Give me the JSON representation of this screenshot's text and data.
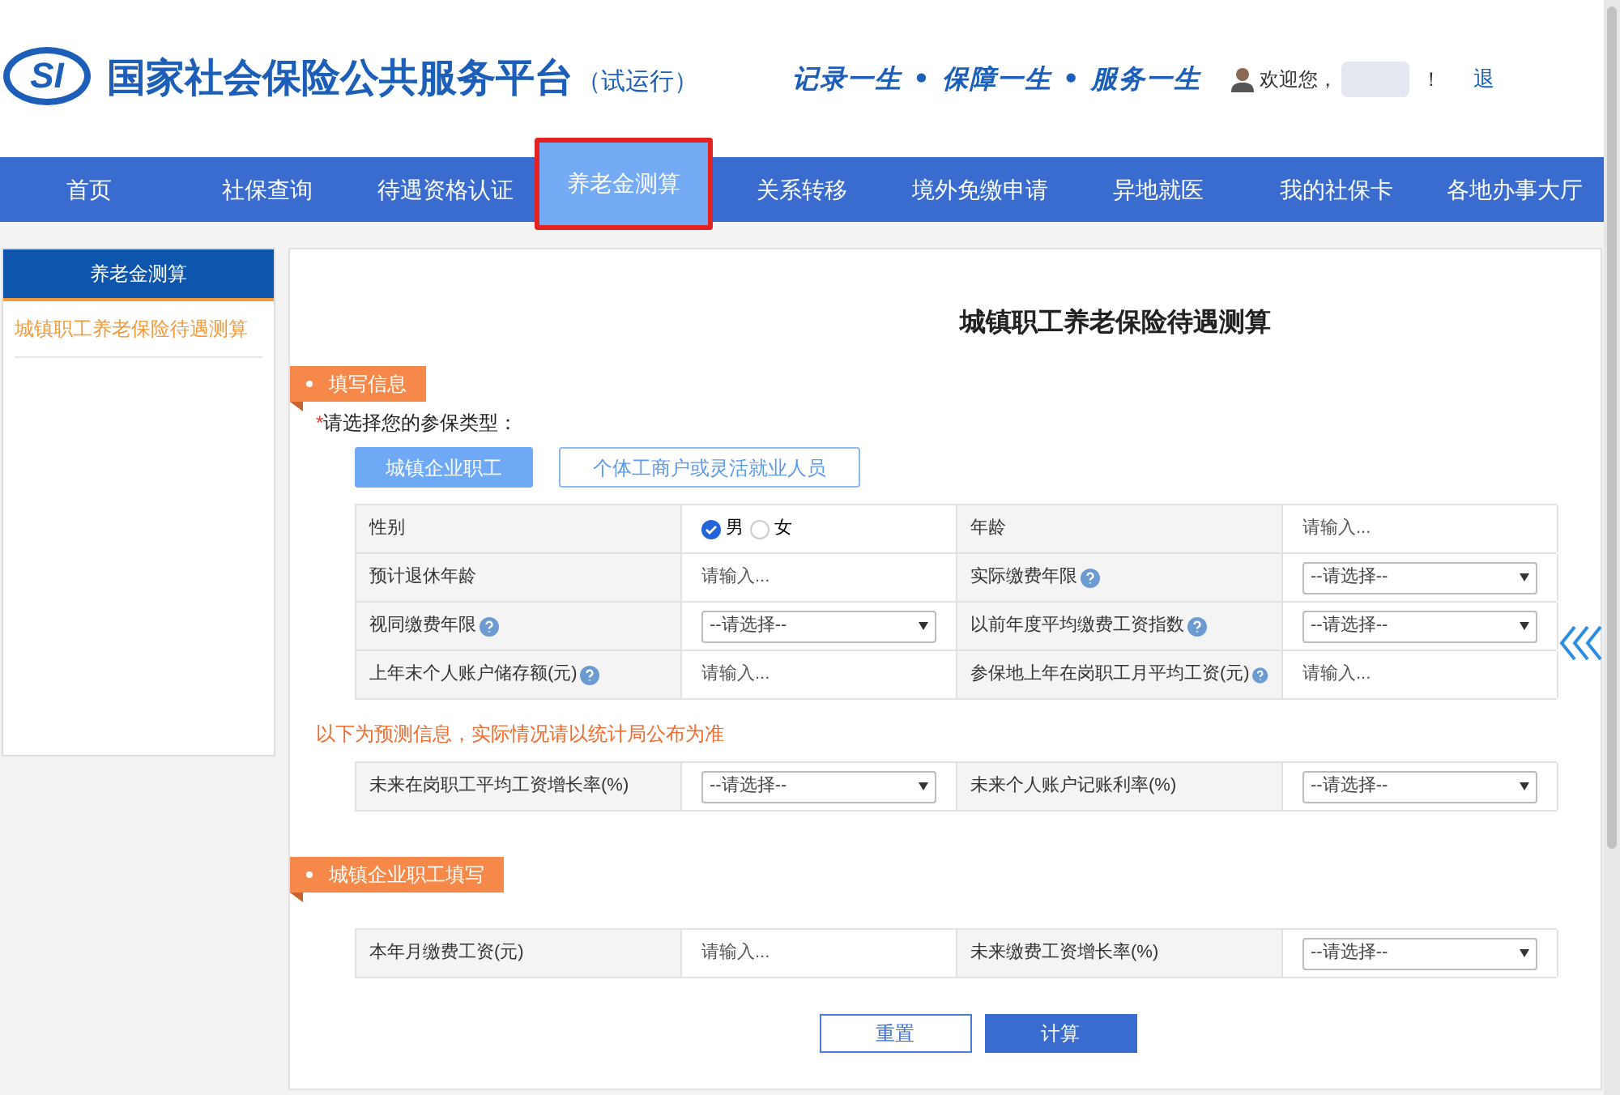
{
  "header": {
    "logo": "SI",
    "site_name": "国家社会保险公共服务平台",
    "trial": "（试运行）",
    "slogan": "记录一生 • 保障一生 • 服务一生",
    "welcome": "欢迎您，",
    "welcome_end": "！",
    "logout": "退"
  },
  "nav": [
    {
      "label": "首页",
      "selected": false,
      "annotated": false
    },
    {
      "label": "社保查询",
      "selected": false,
      "annotated": false
    },
    {
      "label": "待遇资格认证",
      "selected": false,
      "annotated": false
    },
    {
      "label": "养老金测算",
      "selected": true,
      "annotated": true
    },
    {
      "label": "关系转移",
      "selected": false,
      "annotated": false
    },
    {
      "label": "境外免缴申请",
      "selected": false,
      "annotated": false
    },
    {
      "label": "异地就医",
      "selected": false,
      "annotated": false
    },
    {
      "label": "我的社保卡",
      "selected": false,
      "annotated": false
    },
    {
      "label": "各地办事大厅",
      "selected": false,
      "annotated": false
    }
  ],
  "sidebar": {
    "title": "养老金测算",
    "items": [
      {
        "label": "城镇职工养老保险待遇测算",
        "selected": true
      }
    ]
  },
  "main": {
    "title": "城镇职工养老保险待遇测算",
    "section1": {
      "title": "填写信息",
      "prompt_mark": "*",
      "prompt": "请选择您的参保类型：",
      "types": [
        {
          "label": "城镇企业职工",
          "selected": true
        },
        {
          "label": "个体工商户或灵活就业人员",
          "selected": false
        }
      ],
      "rows": [
        [
          {
            "label": "性别",
            "help": false,
            "control": {
              "kind": "radio",
              "options": [
                {
                  "label": "男",
                  "selected": true
                },
                {
                  "label": "女",
                  "selected": false
                }
              ]
            }
          },
          {
            "label": "年龄",
            "help": false,
            "control": {
              "kind": "input",
              "placeholder": "请输入..."
            }
          }
        ],
        [
          {
            "label": "预计退休年龄",
            "help": false,
            "control": {
              "kind": "input",
              "placeholder": "请输入..."
            }
          },
          {
            "label": "实际缴费年限",
            "help": true,
            "control": {
              "kind": "select",
              "value": "--请选择--"
            }
          }
        ],
        [
          {
            "label": "视同缴费年限",
            "help": true,
            "control": {
              "kind": "select",
              "value": "--请选择--"
            }
          },
          {
            "label": "以前年度平均缴费工资指数",
            "help": true,
            "control": {
              "kind": "select",
              "value": "--请选择--"
            }
          }
        ],
        [
          {
            "label": "上年末个人账户储存额(元)",
            "help": true,
            "control": {
              "kind": "input",
              "placeholder": "请输入..."
            }
          },
          {
            "label": "参保地上年在岗职工月平均工资(元)",
            "help": true,
            "control": {
              "kind": "input",
              "placeholder": "请输入..."
            }
          }
        ]
      ],
      "notice": "以下为预测信息，实际情况请以统计局公布为准",
      "forecast_rows": [
        [
          {
            "label": "未来在岗职工平均工资增长率(%)",
            "help": false,
            "control": {
              "kind": "select",
              "value": "--请选择--"
            }
          },
          {
            "label": "未来个人账户记账利率(%)",
            "help": false,
            "control": {
              "kind": "select",
              "value": "--请选择--"
            }
          }
        ]
      ]
    },
    "section2": {
      "title": "城镇企业职工填写",
      "rows": [
        [
          {
            "label": "本年月缴费工资(元)",
            "help": false,
            "control": {
              "kind": "input",
              "placeholder": "请输入..."
            }
          },
          {
            "label": "未来缴费工资增长率(%)",
            "help": false,
            "control": {
              "kind": "select",
              "value": "--请选择--"
            }
          }
        ]
      ]
    },
    "buttons": [
      {
        "label": "重置",
        "kind": "secondary"
      },
      {
        "label": "计算",
        "kind": "primary"
      }
    ]
  }
}
